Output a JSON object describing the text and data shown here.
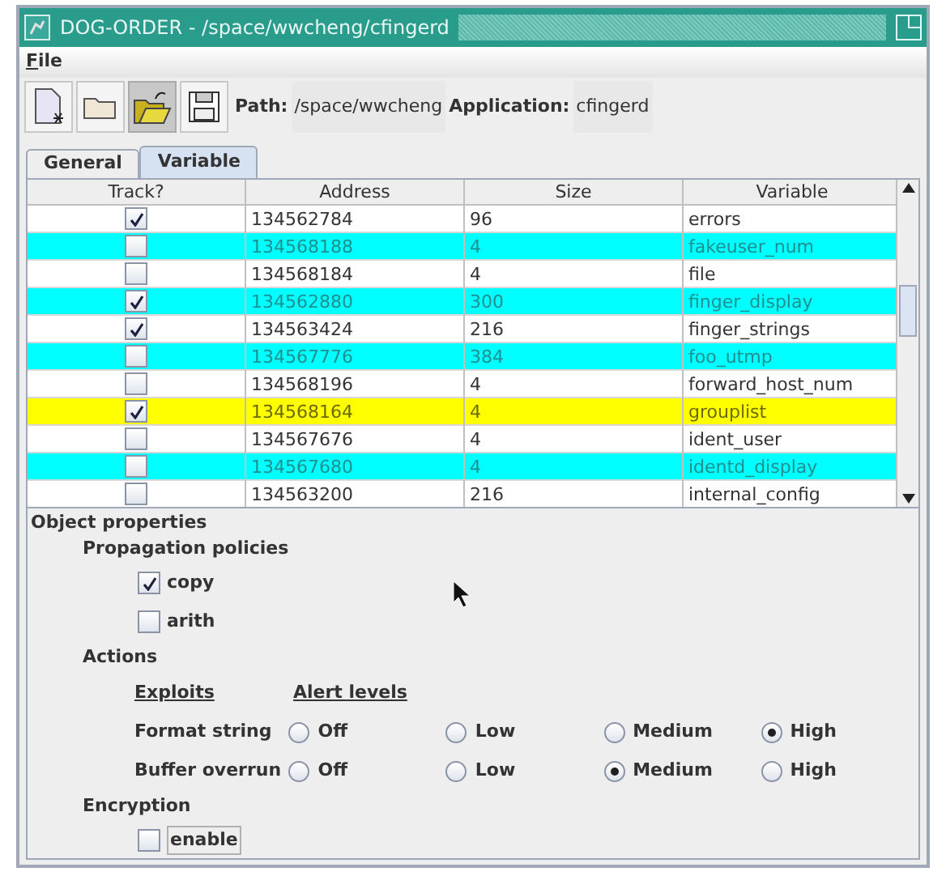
{
  "window": {
    "title": "DOG-ORDER - /space/wwcheng/cfingerd"
  },
  "menu": [
    {
      "label": "File"
    }
  ],
  "toolbar": {
    "path_label": "Path:",
    "path_value": "/space/wwcheng",
    "app_label": "Application:",
    "app_value": "cfingerd"
  },
  "tabs": [
    {
      "label": "General",
      "selected": false
    },
    {
      "label": "Variable",
      "selected": true
    }
  ],
  "table": {
    "columns": [
      "Track?",
      "Address",
      "Size",
      "Variable"
    ],
    "rows": [
      {
        "track": true,
        "address": "134562784",
        "size": "96",
        "variable": "errors",
        "color": "#ffffff"
      },
      {
        "track": false,
        "address": "134568188",
        "size": "4",
        "variable": "fakeuser_num",
        "color": "#00ffff"
      },
      {
        "track": false,
        "address": "134568184",
        "size": "4",
        "variable": "file",
        "color": "#ffffff"
      },
      {
        "track": true,
        "address": "134562880",
        "size": "300",
        "variable": "finger_display",
        "color": "#00ffff"
      },
      {
        "track": true,
        "address": "134563424",
        "size": "216",
        "variable": "finger_strings",
        "color": "#ffffff"
      },
      {
        "track": false,
        "address": "134567776",
        "size": "384",
        "variable": "foo_utmp",
        "color": "#00ffff"
      },
      {
        "track": false,
        "address": "134568196",
        "size": "4",
        "variable": "forward_host_num",
        "color": "#ffffff"
      },
      {
        "track": true,
        "address": "134568164",
        "size": "4",
        "variable": "grouplist",
        "color": "#ffff00"
      },
      {
        "track": false,
        "address": "134567676",
        "size": "4",
        "variable": "ident_user",
        "color": "#ffffff"
      },
      {
        "track": false,
        "address": "134567680",
        "size": "4",
        "variable": "identd_display",
        "color": "#00ffff"
      },
      {
        "track": false,
        "address": "134563200",
        "size": "216",
        "variable": "internal_config",
        "color": "#ffffff"
      }
    ]
  },
  "properties": {
    "title": "Object properties",
    "propagation": {
      "title": "Propagation policies",
      "options": [
        {
          "label": "copy",
          "checked": true
        },
        {
          "label": "arith",
          "checked": false
        }
      ]
    },
    "actions": {
      "title": "Actions",
      "headers": [
        "Exploits",
        "Alert levels"
      ],
      "rows": [
        {
          "label": "Format string",
          "options": [
            {
              "label": "Off",
              "selected": false
            },
            {
              "label": "Low",
              "selected": false
            },
            {
              "label": "Medium",
              "selected": false
            },
            {
              "label": "High",
              "selected": true
            }
          ]
        },
        {
          "label": "Buffer overrun",
          "options": [
            {
              "label": "Off",
              "selected": false
            },
            {
              "label": "Low",
              "selected": false
            },
            {
              "label": "Medium",
              "selected": true
            },
            {
              "label": "High",
              "selected": false
            }
          ]
        }
      ]
    },
    "encryption": {
      "title": "Encryption",
      "option": {
        "label": "enable",
        "checked": false
      }
    }
  }
}
